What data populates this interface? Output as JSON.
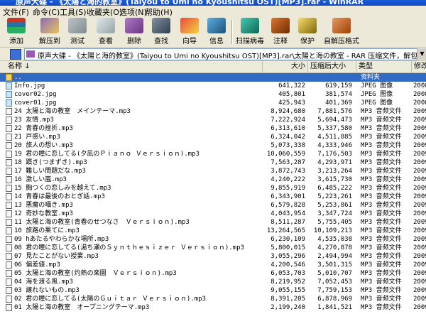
{
  "window": {
    "title": "原声大碟 - 《太陽と海的教室》(Taiyou to Umi no Kyoushitsu OST)[MP3].rar - WinRAR"
  },
  "menu": [
    {
      "label": "文件(F)"
    },
    {
      "label": "命令(C)"
    },
    {
      "label": "工具(S)"
    },
    {
      "label": "收藏夹(O)"
    },
    {
      "label": "选项(N)"
    },
    {
      "label": "帮助(H)"
    }
  ],
  "toolbar": [
    {
      "label": "添加",
      "icon": "books-stack-icon",
      "color": "#c0392b"
    },
    {
      "label": "解压到",
      "icon": "extract-folder-icon",
      "color": "#8e6bb8"
    },
    {
      "label": "测试",
      "icon": "test-checkmark-icon",
      "color": "#7f8c8d"
    },
    {
      "label": "查看",
      "icon": "view-glasses-icon",
      "color": "#95a5a6"
    },
    {
      "label": "删除",
      "icon": "delete-icon",
      "color": "#6c3483"
    },
    {
      "label": "查找",
      "icon": "find-binoculars-icon",
      "color": "#5d6d7e"
    },
    {
      "label": "向导",
      "icon": "wizard-icon",
      "color": "#b03a2e"
    },
    {
      "label": "信息",
      "icon": "info-icon",
      "color": "#2e86c1"
    },
    {
      "label": "扫描病毒",
      "icon": "virus-scan-icon",
      "color": "#117a65"
    },
    {
      "label": "注释",
      "icon": "comment-icon",
      "color": "#6e2c00"
    },
    {
      "label": "保护",
      "icon": "protect-shield-icon",
      "color": "#7d6608"
    },
    {
      "label": "自解压格式",
      "icon": "sfx-icon",
      "color": "#a04000"
    }
  ],
  "pathbar": {
    "text": "原声大碟 - 《太陽と海的教室》(Taiyou to Umi no Kyoushitsu OST)[MP3].rar\\太陽と海の教室 - RAR 压缩文件，解包大小为 162,873,146 字节"
  },
  "columns": [
    {
      "label": "名称"
    },
    {
      "label": "大小"
    },
    {
      "label": "压缩后大小"
    },
    {
      "label": "类型"
    },
    {
      "label": "修改"
    }
  ],
  "files": [
    {
      "name": "..",
      "size": "",
      "packed": "",
      "type": "资料夹",
      "mod": "",
      "kind": "folder"
    },
    {
      "name": "Info.jpg",
      "size": "641,322",
      "packed": "619,159",
      "type": "JPEG 图像",
      "mod": "2008-",
      "kind": "img"
    },
    {
      "name": "cover02.jpg",
      "size": "405,801",
      "packed": "381,574",
      "type": "JPEG 图像",
      "mod": "2008-",
      "kind": "img"
    },
    {
      "name": "cover01.jpg",
      "size": "425,943",
      "packed": "401,369",
      "type": "JPEG 图像",
      "mod": "2008-",
      "kind": "img"
    },
    {
      "name": "24 太陽と海の教室　メインテーマ.mp3",
      "size": "8,924,680",
      "packed": "7,881,576",
      "type": "MP3 音频文件",
      "mod": "2009-",
      "kind": "mp3"
    },
    {
      "name": "23 友情.mp3",
      "size": "7,222,924",
      "packed": "5,694,473",
      "type": "MP3 音频文件",
      "mod": "2009-",
      "kind": "mp3"
    },
    {
      "name": "22 青春の挫折.mp3",
      "size": "6,313,610",
      "packed": "5,337,580",
      "type": "MP3 音频文件",
      "mod": "2009-",
      "kind": "mp3"
    },
    {
      "name": "21 戸惑い.mp3",
      "size": "6,324,042",
      "packed": "4,511,885",
      "type": "MP3 音频文件",
      "mod": "2009-",
      "kind": "mp3"
    },
    {
      "name": "20 旅人の想い.mp3",
      "size": "5,073,338",
      "packed": "4,333,946",
      "type": "MP3 音频文件",
      "mod": "2009-",
      "kind": "mp3"
    },
    {
      "name": "19 君の瞳に恋してる(夕凪のＰｉａｎｏ Ｖｅｒｓｉｏｎ).mp3",
      "size": "10,060,559",
      "packed": "7,176,503",
      "type": "MP3 音频文件",
      "mod": "2009-",
      "kind": "mp3"
    },
    {
      "name": "18 躓き(つまずき).mp3",
      "size": "7,563,287",
      "packed": "4,293,971",
      "type": "MP3 音频文件",
      "mod": "2009-",
      "kind": "mp3"
    },
    {
      "name": "17 難しい問題だな.mp3",
      "size": "3,872,743",
      "packed": "3,213,264",
      "type": "MP3 音频文件",
      "mod": "2009-",
      "kind": "mp3"
    },
    {
      "name": "16 激しい嵐.mp3",
      "size": "4,240,222",
      "packed": "3,615,730",
      "type": "MP3 音频文件",
      "mod": "2009-",
      "kind": "mp3"
    },
    {
      "name": "15 胸つくの恋しみを越えて.mp3",
      "size": "9,855,919",
      "packed": "6,485,222",
      "type": "MP3 音频文件",
      "mod": "2009-",
      "kind": "mp3"
    },
    {
      "name": "14 青春は最後のおとぎ話.mp3",
      "size": "6,343,901",
      "packed": "5,223,261",
      "type": "MP3 音频文件",
      "mod": "2009-",
      "kind": "mp3"
    },
    {
      "name": "13 悪魔の囁き.mp3",
      "size": "6,579,828",
      "packed": "5,253,861",
      "type": "MP3 音频文件",
      "mod": "2009-",
      "kind": "mp3"
    },
    {
      "name": "12 奇妙な教室.mp3",
      "size": "4,043,954",
      "packed": "3,347,724",
      "type": "MP3 音频文件",
      "mod": "2009-",
      "kind": "mp3"
    },
    {
      "name": "11 太陽と海の教室(青春のせつなさ　Ｖｅｒｓｉｏｎ).mp3",
      "size": "8,511,287",
      "packed": "5,755,405",
      "type": "MP3 音频文件",
      "mod": "2009-",
      "kind": "mp3"
    },
    {
      "name": "10 旅路の果てに.mp3",
      "size": "13,264,565",
      "packed": "10,109,213",
      "type": "MP3 音频文件",
      "mod": "2009-",
      "kind": "mp3"
    },
    {
      "name": "09 hあたるやわらかな場所.mp3",
      "size": "6,230,109",
      "packed": "4,535,038",
      "type": "MP3 音频文件",
      "mod": "2009-",
      "kind": "mp3"
    },
    {
      "name": "08 君の瞳に恋してる(湯ち瀬のＳｙｎｔｈｅｓｉｚｅｒ Ｖｅｒｓｉｏｎ).mp3",
      "size": "5,800,015",
      "packed": "4,270,878",
      "type": "MP3 音频文件",
      "mod": "2009-",
      "kind": "mp3"
    },
    {
      "name": "07 見たことがない授業.mp3",
      "size": "3,055,296",
      "packed": "2,494,994",
      "type": "MP3 音频文件",
      "mod": "2009-",
      "kind": "mp3"
    },
    {
      "name": "06 偏差値.mp3",
      "size": "4,200,546",
      "packed": "3,501,315",
      "type": "MP3 音频文件",
      "mod": "2009-",
      "kind": "mp3"
    },
    {
      "name": "05 太陽と海の教室(灼熱の楽園　Ｖｅｒｓｉｏｎ).mp3",
      "size": "6,053,703",
      "packed": "5,010,707",
      "type": "MP3 音频文件",
      "mod": "2009-",
      "kind": "mp3"
    },
    {
      "name": "04 海を渡る風.mp3",
      "size": "8,219,952",
      "packed": "7,052,453",
      "type": "MP3 音频文件",
      "mod": "2009-",
      "kind": "mp3"
    },
    {
      "name": "03 譲れないもの.mp3",
      "size": "9,055,155",
      "packed": "7,759,153",
      "type": "MP3 音频文件",
      "mod": "2009-",
      "kind": "mp3"
    },
    {
      "name": "02 君の瞳に恋してる(太陽のＧｕｉｔａｒ Ｖｅｒｓｉｏｎ).mp3",
      "size": "8,391,205",
      "packed": "6,878,969",
      "type": "MP3 音频文件",
      "mod": "2009-",
      "kind": "mp3"
    },
    {
      "name": "01 太陽と海の教室　オープニングテーマ.mp3",
      "size": "2,199,240",
      "packed": "1,841,521",
      "type": "MP3 音频文件",
      "mod": "2009-",
      "kind": "mp3"
    }
  ]
}
